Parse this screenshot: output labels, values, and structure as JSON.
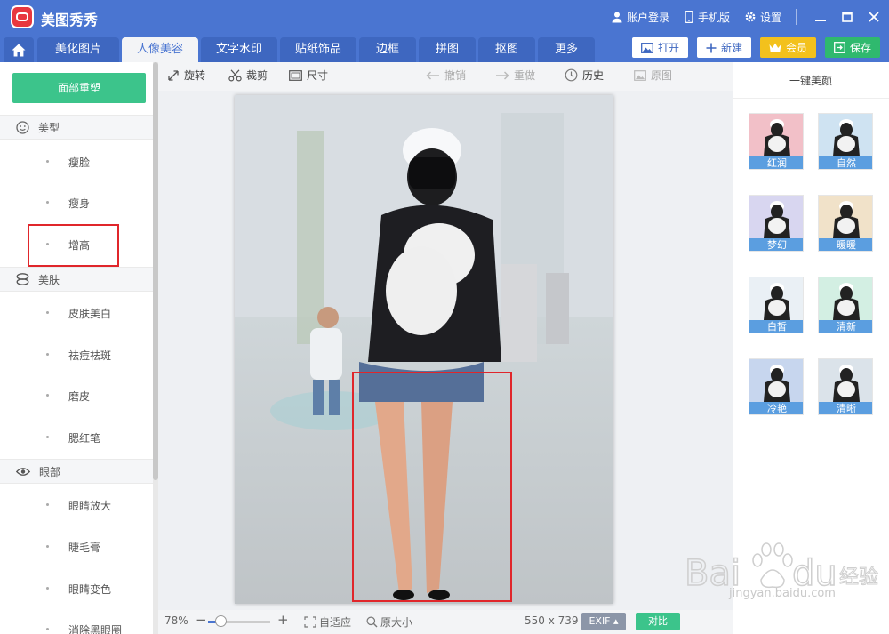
{
  "app": {
    "title": "美图秀秀"
  },
  "titlebar": {
    "account": "账户登录",
    "mobile": "手机版",
    "settings": "设置"
  },
  "tabs": [
    {
      "label": "美化图片"
    },
    {
      "label": "人像美容"
    },
    {
      "label": "文字水印"
    },
    {
      "label": "贴纸饰品"
    },
    {
      "label": "边框"
    },
    {
      "label": "拼图"
    },
    {
      "label": "抠图"
    },
    {
      "label": "更多"
    }
  ],
  "actions": {
    "open": "打开",
    "new": "新建",
    "vip": "会员",
    "save": "保存"
  },
  "left": {
    "reset": "面部重塑",
    "sections": [
      {
        "title": "美型",
        "items": [
          "瘦脸",
          "瘦身",
          "增高"
        ]
      },
      {
        "title": "美肤",
        "items": [
          "皮肤美白",
          "祛痘祛斑",
          "磨皮",
          "腮红笔"
        ]
      },
      {
        "title": "眼部",
        "items": [
          "眼睛放大",
          "睫毛膏",
          "眼睛变色",
          "消除黑眼圈"
        ]
      }
    ]
  },
  "toolbar": {
    "rotate": "旋转",
    "crop": "裁剪",
    "size": "尺寸",
    "undo": "撤销",
    "redo": "重做",
    "history": "历史",
    "original": "原图"
  },
  "bottom": {
    "zoom": "78%",
    "zoom_level": 0.2,
    "fit": "自适应",
    "actual": "原大小",
    "dimensions": "550 x 739",
    "exif": "EXIF ▴",
    "compare": "对比"
  },
  "right": {
    "title": "一键美颜",
    "presets": [
      "红润",
      "自然",
      "梦幻",
      "暖暖",
      "白皙",
      "清新",
      "冷艳",
      "清晰"
    ]
  },
  "watermark": {
    "brand": "Bai",
    "brand2": "du",
    "cn": "经验",
    "url": "jingyan.baidu.com"
  },
  "colors": {
    "primary": "#4a75d1",
    "green": "#3cc48b",
    "gold": "#f3c11c",
    "red": "#e0262b"
  }
}
